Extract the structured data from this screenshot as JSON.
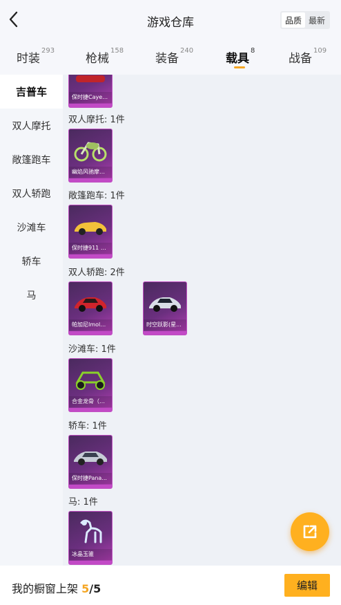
{
  "header": {
    "title": "游戏仓库",
    "sort_options": [
      "品质",
      "最新"
    ],
    "active_sort": 0
  },
  "tabs": [
    {
      "label": "时装",
      "count": "293"
    },
    {
      "label": "枪械",
      "count": "158"
    },
    {
      "label": "装备",
      "count": "240"
    },
    {
      "label": "载具",
      "count": "8"
    },
    {
      "label": "战备",
      "count": "109"
    }
  ],
  "active_tab": 3,
  "sidebar": {
    "items": [
      "吉普车",
      "双人摩托",
      "敞篷跑车",
      "双人轿跑",
      "沙滩车",
      "轿车",
      "马"
    ],
    "active": 0
  },
  "sections": [
    {
      "label": "双人摩托: 1件",
      "cards": [
        {
          "name": "幽焰风驰摩托..."
        }
      ]
    },
    {
      "label": "敞篷跑车: 1件",
      "cards": [
        {
          "name": "保时捷911 敞..."
        }
      ]
    },
    {
      "label": "双人轿跑: 2件",
      "cards": [
        {
          "name": "帕加尼Imola(..."
        },
        {
          "name": "时空跃影(星..."
        }
      ]
    },
    {
      "label": "沙滩车: 1件",
      "cards": [
        {
          "name": "合金龙骨（绿..."
        }
      ]
    },
    {
      "label": "轿车: 1件",
      "cards": [
        {
          "name": "保时捷Pana..."
        }
      ]
    },
    {
      "label": "马: 1件",
      "cards": [
        {
          "name": "冰晶玉骓"
        }
      ]
    }
  ],
  "top_partial_card": {
    "name": "保时捷Cayen..."
  },
  "bottom": {
    "shelf_label": "我的橱窗上架",
    "shelf_current": "5",
    "shelf_sep": "/",
    "shelf_total": "5",
    "edit_label": "编辑"
  },
  "colors": {
    "accent": "#ffb01f",
    "card_purple": "#6a2f7e"
  },
  "icons": {
    "back": "back-arrow-icon",
    "share": "external-link-icon"
  }
}
